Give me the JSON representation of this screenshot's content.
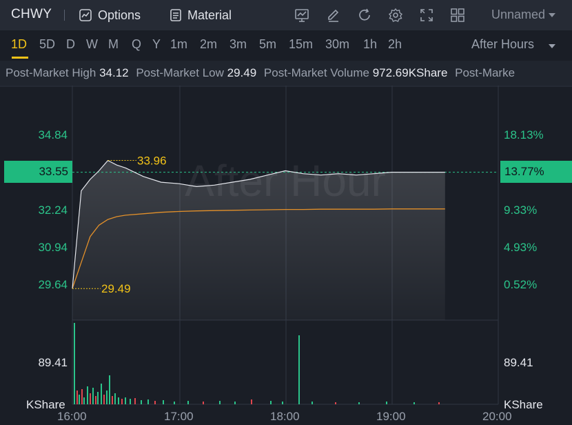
{
  "toolbar": {
    "ticker": "CHWY",
    "options_label": "Options",
    "material_label": "Material",
    "layout_name": "Unnamed",
    "icons": [
      "indicator-icon",
      "draw-icon",
      "refresh-icon",
      "settings-icon",
      "fullscreen-icon",
      "grid-layout-icon"
    ]
  },
  "periods": [
    "1D",
    "5D",
    "D",
    "W",
    "M",
    "Q",
    "Y",
    "1m",
    "2m",
    "3m",
    "5m",
    "15m",
    "30m",
    "1h",
    "2h"
  ],
  "active_period": "1D",
  "session_label": "After Hours",
  "stats": [
    {
      "label": "Post-Market High",
      "value": "34.12"
    },
    {
      "label": "Post-Market Low",
      "value": "29.49"
    },
    {
      "label": "Post-Market Volume",
      "value": "972.69KShare"
    },
    {
      "label": "Post-Marke",
      "value": ""
    }
  ],
  "chart": {
    "watermark": "After Hour",
    "left_axis": [
      "34.84",
      "32.24",
      "30.94",
      "29.64"
    ],
    "right_axis": [
      "18.13%",
      "9.33%",
      "4.93%",
      "0.52%"
    ],
    "current_price": "33.55",
    "current_pct": "13.77%",
    "high_annotation": "33.96",
    "low_annotation": "29.49",
    "volume_axis_left": "89.41",
    "volume_axis_right": "89.41",
    "volume_unit_left": "KShare",
    "volume_unit_right": "KShare",
    "time_labels": [
      "16:00",
      "17:00",
      "18:00",
      "19:00",
      "20:00"
    ],
    "colors": {
      "up": "#2bc48a",
      "down": "#e0464e",
      "annotation": "#f2c318",
      "avg_line": "#e3902a",
      "price_line": "#e6e8ee"
    }
  },
  "chart_data": {
    "type": "line",
    "x": [
      "16:00",
      "16:05",
      "16:10",
      "16:15",
      "16:20",
      "16:25",
      "16:30",
      "16:40",
      "16:50",
      "17:00",
      "17:10",
      "17:20",
      "17:30",
      "17:40",
      "17:50",
      "18:00",
      "18:10",
      "18:20",
      "18:30",
      "18:40",
      "18:50",
      "19:00",
      "19:10",
      "19:20",
      "19:30"
    ],
    "series": [
      {
        "values": [
          29.49,
          32.9,
          33.3,
          33.6,
          33.96,
          33.8,
          33.7,
          33.4,
          33.2,
          33.15,
          33.05,
          33.1,
          33.2,
          33.3,
          33.45,
          33.6,
          33.5,
          33.45,
          33.5,
          33.45,
          33.5,
          33.55,
          33.55,
          33.55,
          33.55
        ]
      },
      {
        "values": [
          29.49,
          30.4,
          31.3,
          31.7,
          31.9,
          32.0,
          32.05,
          32.1,
          32.15,
          32.18,
          32.2,
          32.21,
          32.22,
          32.23,
          32.24,
          32.25,
          32.25,
          32.26,
          32.26,
          32.26,
          32.26,
          32.27,
          32.27,
          32.27,
          32.27
        ]
      }
    ],
    "ylim": [
      29.0,
      35.5
    ],
    "xlim": [
      "16:00",
      "20:00"
    ]
  }
}
